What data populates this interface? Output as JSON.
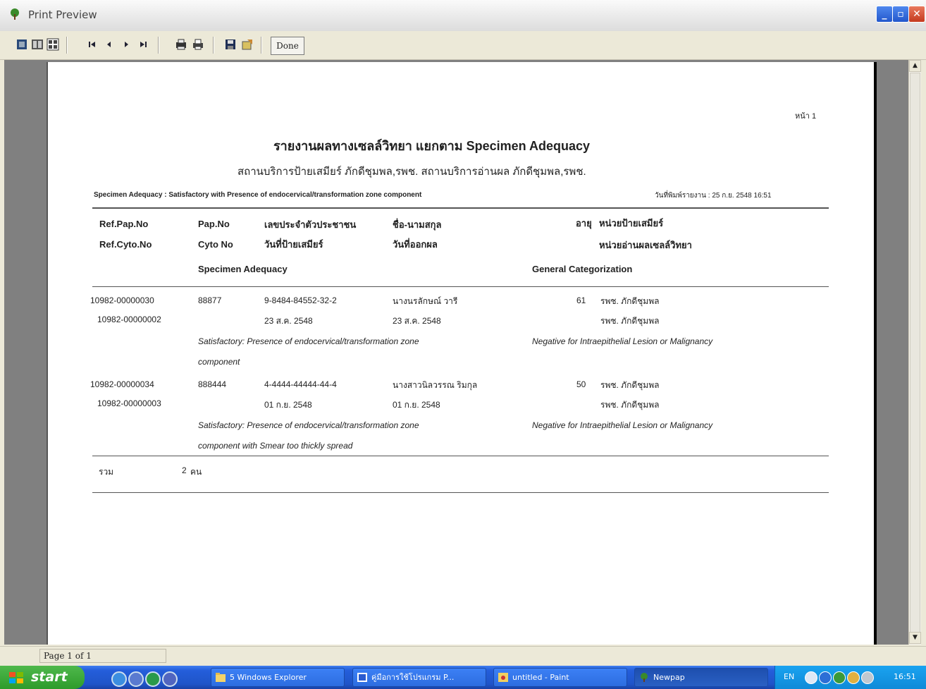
{
  "window": {
    "title": "Print Preview"
  },
  "toolbar": {
    "done_label": "Done",
    "icons": [
      "one-page-icon",
      "two-page-icon",
      "multi-page-icon",
      "first-page-icon",
      "prev-page-icon",
      "next-page-icon",
      "last-page-icon",
      "print-setup-icon",
      "print-icon",
      "save-icon",
      "export-icon"
    ]
  },
  "report": {
    "page_label": "หน้า 1",
    "title": "รายงานผลทางเซลล์วิทยา  แยกตาม Specimen Adequacy",
    "subtitle": "สถานบริการป้ายเสมียร์ ภักดีชุมพล,รพช.   สถานบริการอ่านผล ภักดีชุมพล,รพช.",
    "filter_line": "Specimen Adequacy : Satisfactory with Presence of endocervical/transformation zone component",
    "print_date": "วันที่พิมพ์รายงาน : 25 ก.ย. 2548 16:51",
    "headers": {
      "ref_pap": "Ref.Pap.No",
      "ref_cyto": "Ref.Cyto.No",
      "pap_no": "Pap.No",
      "cyto_no": "Cyto No",
      "id_no": "เลขประจำตัวประชาชน",
      "smear_date": "วันที่ป้ายเสมียร์",
      "name": "ชื่อ-นามสกุล",
      "result_date": "วันที่ออกผล",
      "age": "อายุ",
      "smear_unit": "หน่วยป้ายเสมียร์",
      "read_unit": "หน่วยอ่านผลเซลล์วิทยา",
      "specimen_adequacy": "Specimen Adequacy",
      "general_cat": "General Categorization"
    },
    "records": [
      {
        "ref_pap": "10982-00000030",
        "ref_cyto": "10982-00000002",
        "pap_no": "88877",
        "id_no": "9-8484-84552-32-2",
        "smear_date": "23 ส.ค. 2548",
        "name": "นางนรลักษณ์ วารี",
        "result_date": "23 ส.ค. 2548",
        "age": "61",
        "smear_unit": "รพช. ภักดีชุมพล",
        "read_unit": "รพช. ภักดีชุมพล",
        "adequacy_1": "Satisfactory: Presence of endocervical/transformation zone",
        "adequacy_2": "component",
        "category": "Negative for Intraepithelial Lesion or Malignancy"
      },
      {
        "ref_pap": "10982-00000034",
        "ref_cyto": "10982-00000003",
        "pap_no": "888444",
        "id_no": "4-4444-44444-44-4",
        "smear_date": "01 ก.ย. 2548",
        "name": "นางสาวนิลวรรณ ริมกุล",
        "result_date": "01 ก.ย. 2548",
        "age": "50",
        "smear_unit": "รพช. ภักดีชุมพล",
        "read_unit": "รพช. ภักดีชุมพล",
        "adequacy_1": "Satisfactory: Presence of endocervical/transformation zone",
        "adequacy_2": "component with Smear too thickly spread",
        "category": "Negative for Intraepithelial Lesion or Malignancy"
      }
    ],
    "total_label": "รวม",
    "total_count": "2",
    "total_unit": "คน"
  },
  "status": {
    "page_text": "Page 1 of 1"
  },
  "taskbar": {
    "start_label": "start",
    "tasks": [
      {
        "label": "5 Windows Explorer"
      },
      {
        "label": "คู่มือการใช้โปรแกรม P..."
      },
      {
        "label": "untitled - Paint"
      },
      {
        "label": "Newpap"
      }
    ],
    "lang": "EN",
    "clock": "16:51"
  }
}
